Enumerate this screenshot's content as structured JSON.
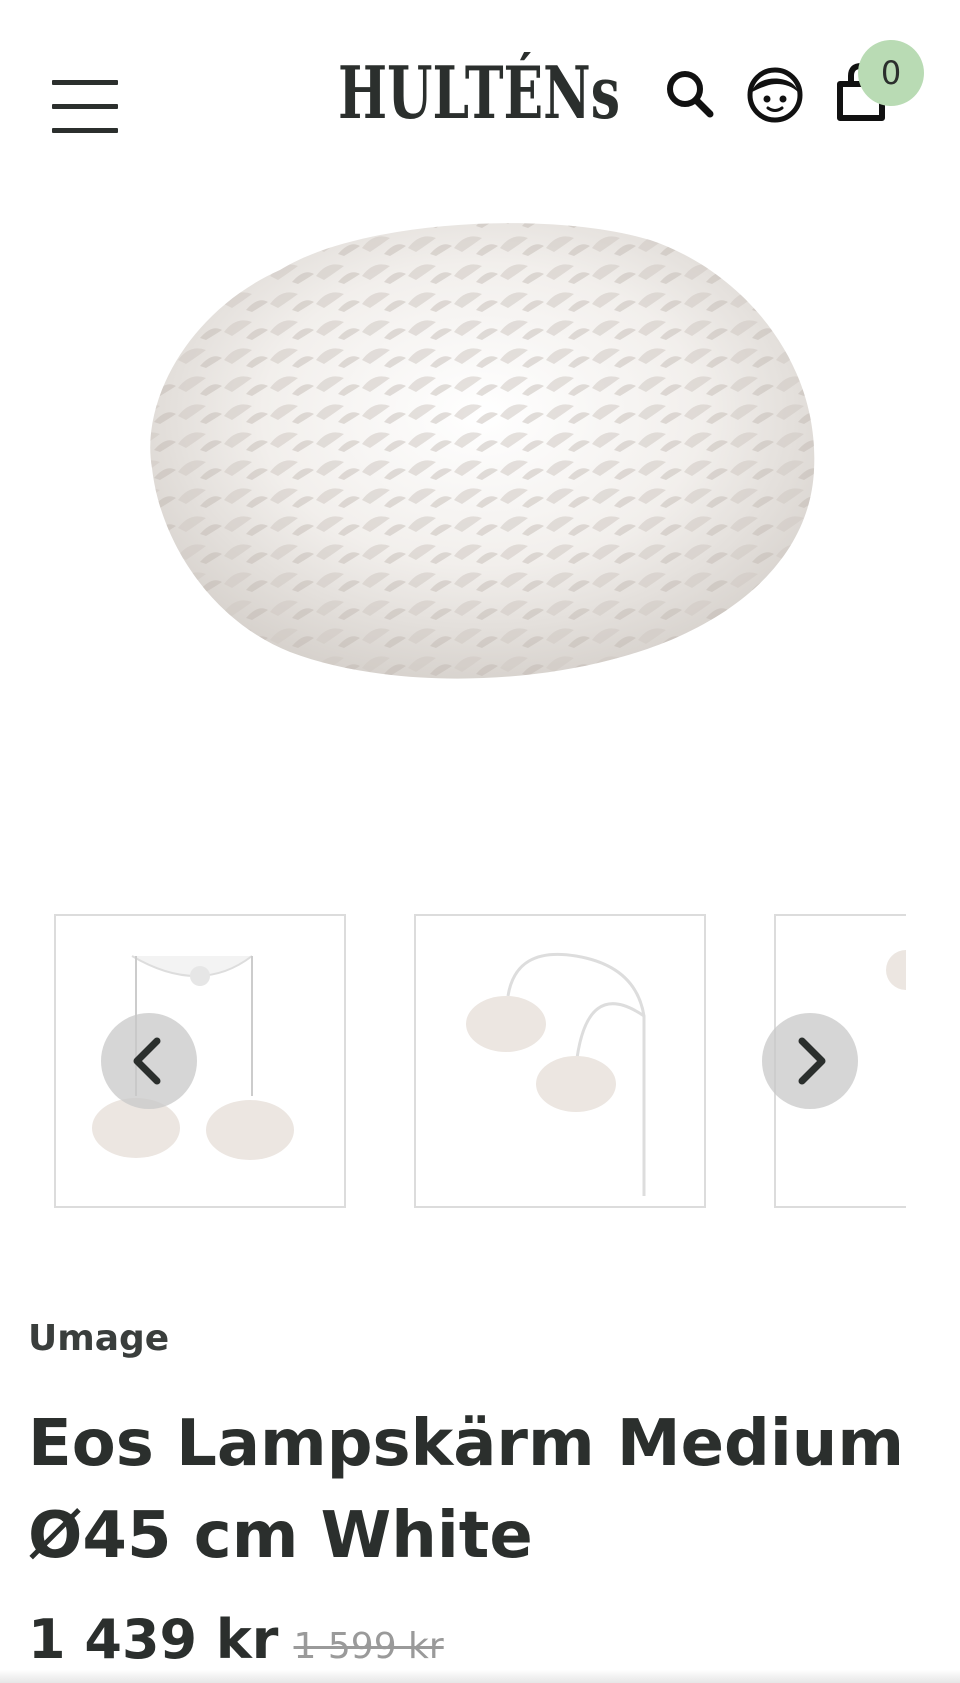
{
  "header": {
    "logo_text": "HULTÉNs",
    "cart_count": "0"
  },
  "product": {
    "brand": "Umage",
    "title_line1": "Eos Lampskärm Medium",
    "title_line2": "Ø45 cm White",
    "price": "1 439 kr",
    "old_price": "1 599 kr"
  },
  "gallery": {
    "thumbnails": [
      {
        "icon": "pendant-double-thumbnail"
      },
      {
        "icon": "wall-lamp-double-thumbnail"
      },
      {
        "icon": "lamp-thumbnail-partial"
      }
    ]
  },
  "colors": {
    "text": "#2b2f2d",
    "badge": "#b9dbb4",
    "old_price": "#9a9a9a"
  }
}
